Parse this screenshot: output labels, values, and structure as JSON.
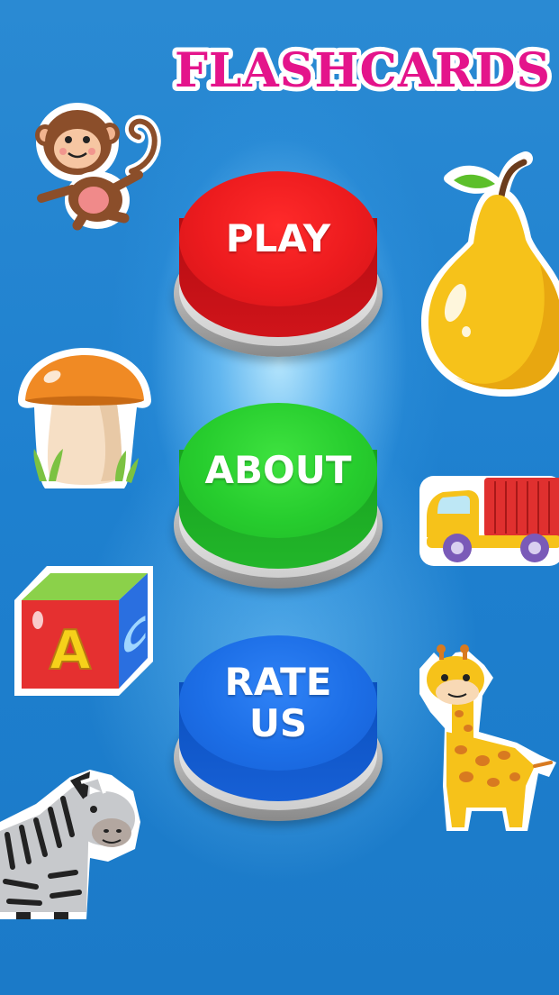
{
  "title": "FLASHCARDS",
  "buttons": {
    "play": "PLAY",
    "about": "ABOUT",
    "rate": "RATE\nUS"
  },
  "stickers": {
    "block_letter_front": "A",
    "block_letter_side": "C"
  },
  "colors": {
    "background": "#1f83d0",
    "title_pink": "#e4148b",
    "play_red": "#ec1b1e",
    "about_green": "#27cd2e",
    "rate_blue": "#1c6ee6"
  },
  "icons": [
    "monkey-icon",
    "pear-icon",
    "mushroom-icon",
    "truck-icon",
    "abc-block-icon",
    "giraffe-icon",
    "zebra-icon"
  ]
}
